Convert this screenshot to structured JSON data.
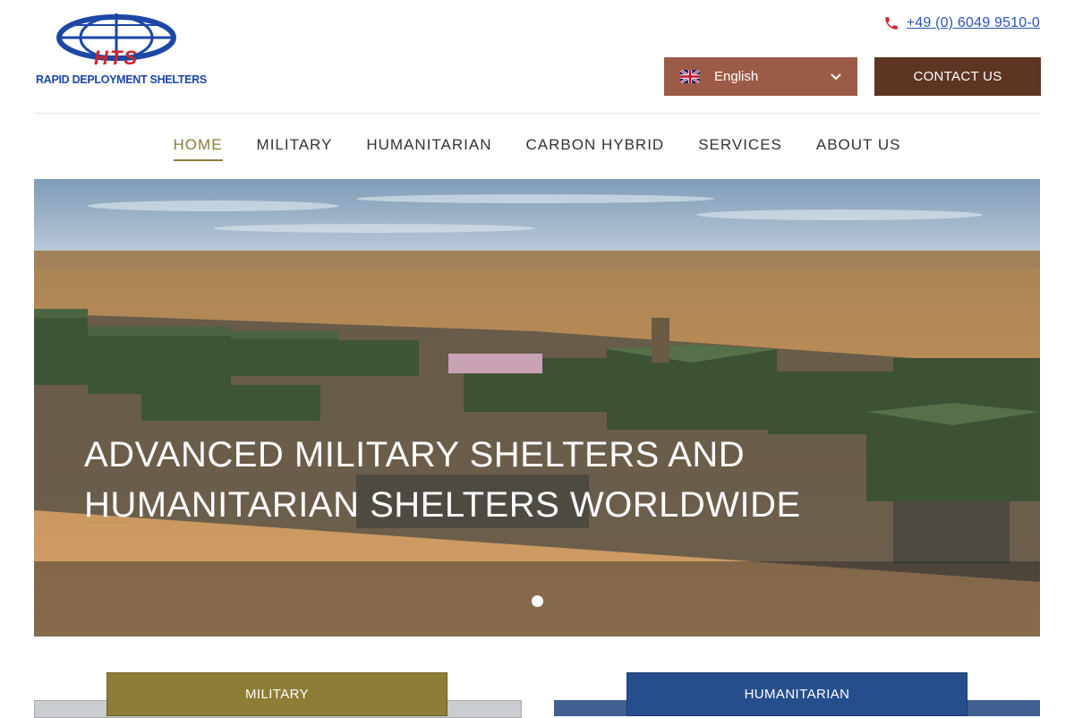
{
  "brand": {
    "abbr": "HTS",
    "tagline": "RAPID DEPLOYMENT SHELTERS",
    "globe_color": "#1c47a6",
    "abbr_color": "#d2232a"
  },
  "header": {
    "phone": "+49 (0) 6049 9510-0",
    "phone_icon": "phone-icon",
    "language": {
      "selected": "English",
      "flag": "uk-flag-icon"
    },
    "contact_label": "CONTACT US",
    "lang_color": "#9c5b46",
    "contact_color": "#5e3523"
  },
  "nav": {
    "items": [
      {
        "label": "HOME",
        "active": true
      },
      {
        "label": "MILITARY",
        "active": false
      },
      {
        "label": "HUMANITARIAN",
        "active": false
      },
      {
        "label": "CARBON HYBRID",
        "active": false
      },
      {
        "label": "SERVICES",
        "active": false
      },
      {
        "label": "ABOUT US",
        "active": false
      }
    ],
    "active_color": "#8e7a3a"
  },
  "hero": {
    "title_line1": "ADVANCED MILITARY SHELTERS AND",
    "title_line2": "HUMANITARIAN SHELTERS WORLDWIDE",
    "slides": 1,
    "current_slide": 1
  },
  "categories": [
    {
      "label": "MILITARY",
      "color": "#8d7d37"
    },
    {
      "label": "HUMANITARIAN",
      "color": "#264e8c"
    }
  ]
}
